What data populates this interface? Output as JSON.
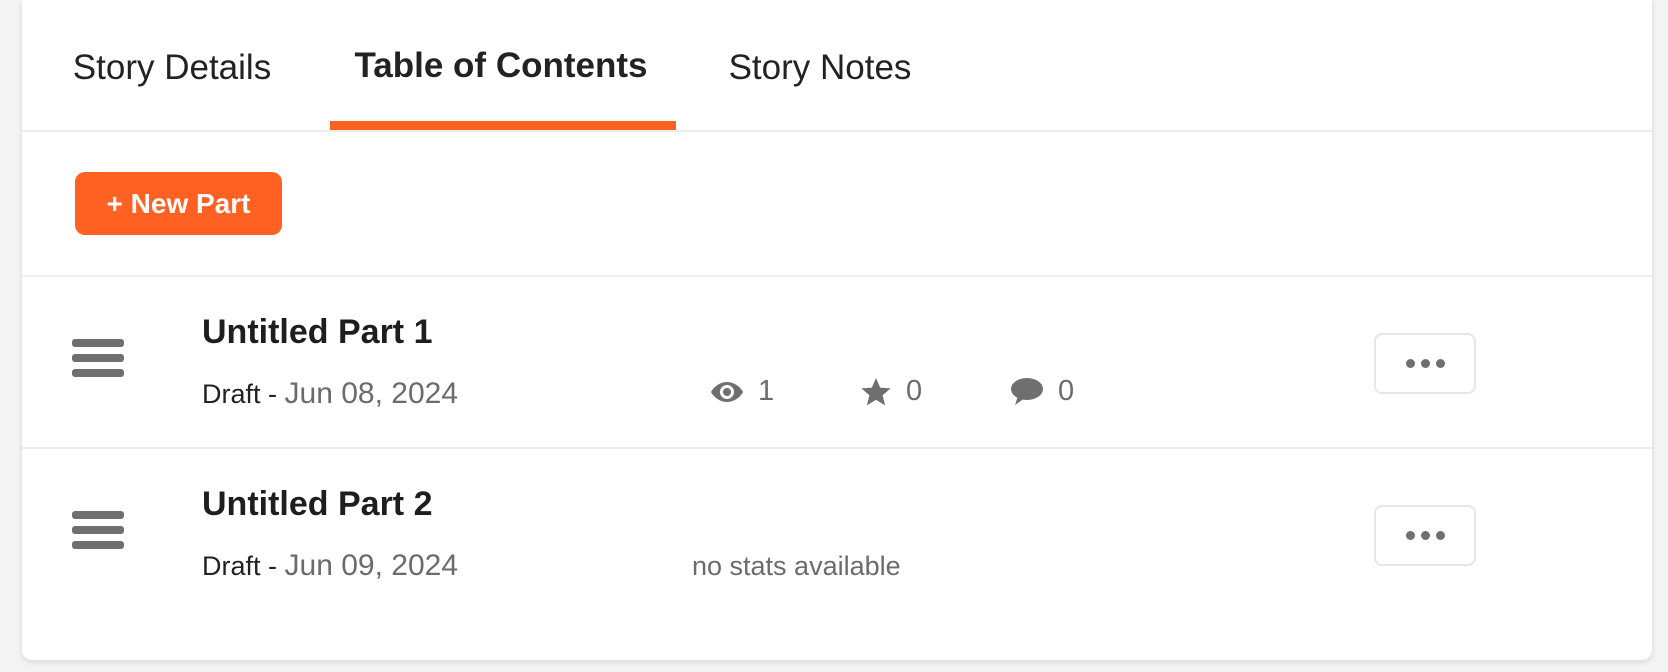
{
  "tabs": [
    {
      "label": "Story Details",
      "active": false
    },
    {
      "label": "Table of Contents",
      "active": true
    },
    {
      "label": "Story Notes",
      "active": false
    }
  ],
  "toolbar": {
    "new_part_label": "+ New Part"
  },
  "parts": [
    {
      "title": "Untitled Part 1",
      "status": "Draft",
      "separator": " - ",
      "date": "Jun 08, 2024",
      "stats": {
        "reads": "1",
        "votes": "0",
        "comments": "0"
      }
    },
    {
      "title": "Untitled Part 2",
      "status": "Draft",
      "separator": " - ",
      "date": "Jun 09, 2024",
      "no_stats_text": "no stats available"
    }
  ],
  "icons": {
    "drag": "drag-handle-icon",
    "reads": "eye-icon",
    "votes": "star-icon",
    "comments": "comment-icon",
    "more": "more-options-icon"
  },
  "colors": {
    "accent": "#ff6122",
    "icon_gray": "#6f6f6f",
    "muted_text": "#6b6b6b"
  }
}
